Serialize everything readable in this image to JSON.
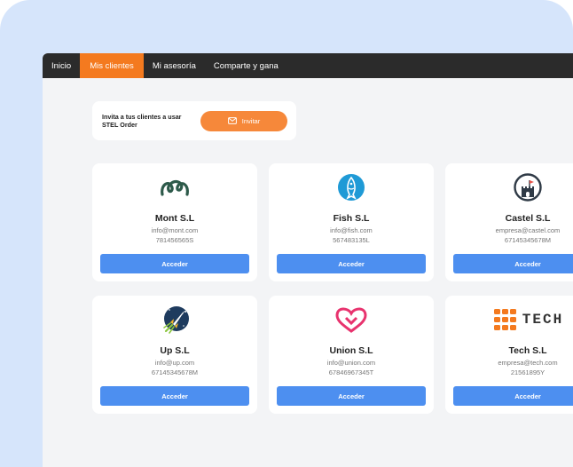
{
  "nav": {
    "items": [
      {
        "label": "Inicio",
        "active": false
      },
      {
        "label": "Mis clientes",
        "active": true
      },
      {
        "label": "Mi asesoría",
        "active": false
      },
      {
        "label": "Comparte y gana",
        "active": false
      }
    ]
  },
  "invite": {
    "text": "Invita a tus clientes a usar STEL Order",
    "button_label": "Invitar",
    "button_icon": "mail-icon"
  },
  "clients": [
    {
      "name": "Mont S.L",
      "email": "info@mont.com",
      "cif": "781456565S",
      "button_label": "Acceder",
      "logo": "mont-logo-icon"
    },
    {
      "name": "Fish S.L",
      "email": "info@fish.com",
      "cif": "567483135L",
      "button_label": "Acceder",
      "logo": "fish-logo-icon"
    },
    {
      "name": "Castel S.L",
      "email": "empresa@castel.com",
      "cif": "67145345678M",
      "button_label": "Acceder",
      "logo": "castle-logo-icon"
    },
    {
      "name": "Up S.L",
      "email": "info@up.com",
      "cif": "67145345678M",
      "button_label": "Acceder",
      "logo": "rocket-logo-icon"
    },
    {
      "name": "Union S.L",
      "email": "info@union.com",
      "cif": "67846967345T",
      "button_label": "Acceder",
      "logo": "union-logo-icon"
    },
    {
      "name": "Tech S.L",
      "email": "empresa@tech.com",
      "cif": "21561895Y",
      "button_label": "Acceder",
      "logo": "tech-logo-icon",
      "logo_text": "TECH"
    }
  ],
  "colors": {
    "accent": "#f47a1f",
    "primary_button": "#4d8ff0",
    "nav_bg": "#2b2b2b",
    "backdrop": "#d6e5fb"
  }
}
